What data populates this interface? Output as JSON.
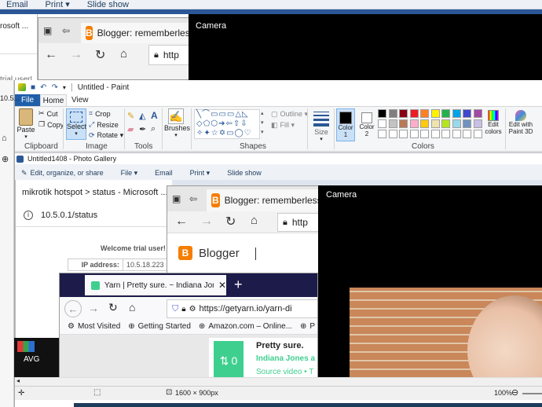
{
  "bg_toolbar": {
    "items": [
      "Email",
      "Print ▾",
      "Slide show"
    ]
  },
  "left_edge_text": [
    "rosoft ...",
    "trial user!",
    "10.5..."
  ],
  "edge_back": {
    "title": "Blogger: rememberlessf",
    "addr": "http"
  },
  "camera_back": {
    "title": "Camera"
  },
  "paint": {
    "title": "Untitled - Paint",
    "tabs": [
      "File",
      "Home",
      "View"
    ],
    "clipboard": {
      "paste": "Paste",
      "cut": "Cut",
      "copy": "Copy",
      "group": "Clipboard"
    },
    "image": {
      "select": "Select",
      "crop": "Crop",
      "resize": "Resize",
      "rotate": "Rotate ▾",
      "group": "Image"
    },
    "tools": {
      "group": "Tools"
    },
    "brushes": {
      "label": "Brushes"
    },
    "shapes": {
      "outline": "Outline ▾",
      "fill": "Fill ▾",
      "group": "Shapes"
    },
    "size": {
      "label": "Size"
    },
    "colors": {
      "color1": "Color 1",
      "color2": "Color 2",
      "edit": "Edit colors",
      "edit_paint3d": "Edit with Paint 3D",
      "group": "Colors"
    },
    "palette": [
      "#000000",
      "#7f7f7f",
      "#880015",
      "#ed1c24",
      "#ff7f27",
      "#fff200",
      "#22b14c",
      "#00a2e8",
      "#3f48cc",
      "#a349a4",
      "#ffffff",
      "#c3c3c3",
      "#b97a57",
      "#ffaec9",
      "#ffc90e",
      "#efe4b0",
      "#b5e61d",
      "#99d9ea",
      "#7092be",
      "#c8bfe7"
    ],
    "status_size": "1600 × 900px",
    "zoom": "100%"
  },
  "photo_gallery": {
    "title": "Untitled1408 - Photo Gallery",
    "toolbar": [
      "Edit, organize, or share",
      "File ▾",
      "Email",
      "Print ▾",
      "Slide show"
    ]
  },
  "mikrotik": {
    "title": "mikrotik hotspot > status - Microsoft ...",
    "address": "10.5.0.1/status",
    "welcome": "Welcome trial user!",
    "ip_label": "IP address:",
    "ip_value": "10.5.18.223"
  },
  "edge_front": {
    "title": "Blogger: rememberlessf",
    "addr": "http",
    "page_brand": "Blogger"
  },
  "camera_front": {
    "title": "Camera"
  },
  "firefox": {
    "tab_title": "Yarn | Pretty sure. ~ Indiana Jon",
    "url": "https://getyarn.io/yarn-di",
    "bookmarks": [
      "Most Visited",
      "Getting Started",
      "Amazon.com – Online...",
      "P"
    ],
    "clip_title": "Pretty sure.",
    "clip_movie": "Indiana Jones a",
    "clip_source": "Source video • T",
    "clip_count": "0"
  },
  "avg": {
    "label": "AVG"
  }
}
